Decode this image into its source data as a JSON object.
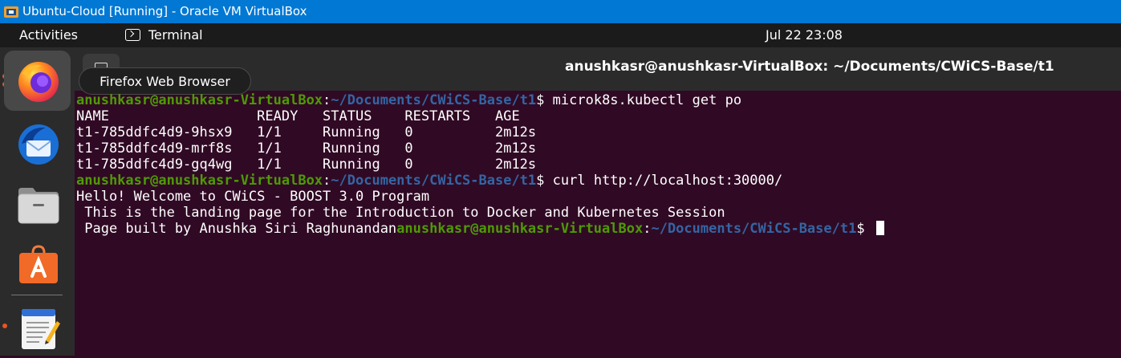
{
  "window": {
    "title": "Ubuntu-Cloud [Running] - Oracle VM VirtualBox"
  },
  "topbar": {
    "activities": "Activities",
    "app_name": "Terminal",
    "clock": "Jul 22  23:08"
  },
  "dock": {
    "tooltip": "Firefox Web Browser",
    "items": [
      {
        "name": "Firefox Web Browser",
        "icon": "firefox-icon"
      },
      {
        "name": "Thunderbird Mail",
        "icon": "thunderbird-icon"
      },
      {
        "name": "Files",
        "icon": "files-icon"
      },
      {
        "name": "Ubuntu Software",
        "icon": "software-icon"
      },
      {
        "name": "Text Editor",
        "icon": "text-editor-icon"
      }
    ]
  },
  "terminal": {
    "title": "anushkasr@anushkasr-VirtualBox: ~/Documents/CWiCS-Base/t1",
    "prompt_user": "anushkasr@anushkasr-VirtualBox",
    "prompt_colon": ":",
    "prompt_path": "~/Documents/CWiCS-Base/t1",
    "prompt_dollar": "$",
    "cmd1": " microk8s.kubectl get po",
    "table_header": "NAME                  READY   STATUS    RESTARTS   AGE",
    "pods": [
      "t1-785ddfc4d9-9hsx9   1/1     Running   0          2m12s",
      "t1-785ddfc4d9-mrf8s   1/1     Running   0          2m12s",
      "t1-785ddfc4d9-gq4wg   1/1     Running   0          2m12s"
    ],
    "cmd2": " curl http://localhost:30000/",
    "output1": "Hello! Welcome to CWiCS - BOOST 3.0 Program",
    "output2": " This is the landing page for the Introduction to Docker and Kubernetes Session",
    "output3": " Page built by Anushka Siri Raghunandan",
    "cmd3": " "
  },
  "colors": {
    "terminal_bg": "#300a24",
    "prompt_user": "#4e9a06",
    "prompt_path": "#3465a4",
    "titlebar": "#0078d4",
    "accent": "#e95420"
  }
}
